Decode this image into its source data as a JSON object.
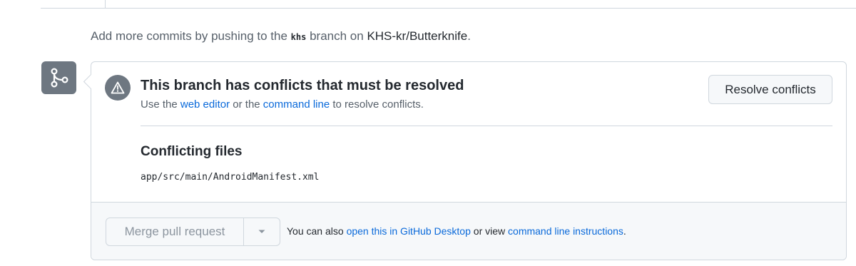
{
  "hint": {
    "prefix": "Add more commits by pushing to the",
    "branch": "khs",
    "middle": "branch on",
    "repo": "KHS-kr/Butterknife",
    "suffix": "."
  },
  "conflict": {
    "title": "This branch has conflicts that must be resolved",
    "sub_prefix": "Use the",
    "web_editor_link": "web editor",
    "sub_middle": "or the",
    "command_line_link": "command line",
    "sub_suffix": "to resolve conflicts.",
    "resolve_button": "Resolve conflicts"
  },
  "files": {
    "title": "Conflicting files",
    "items": [
      "app/src/main/AndroidManifest.xml"
    ]
  },
  "footer": {
    "merge_button": "Merge pull request",
    "text_prefix": "You can also",
    "desktop_link": "open this in GitHub Desktop",
    "text_middle": "or view",
    "instructions_link": "command line instructions",
    "text_suffix": "."
  },
  "icons": {
    "merge": "git-merge-icon",
    "warning": "alert-icon",
    "dropdown": "triangle-down-icon"
  },
  "colors": {
    "link": "#0969da",
    "icon_bg": "#6e7781",
    "border": "#d0d7de"
  }
}
